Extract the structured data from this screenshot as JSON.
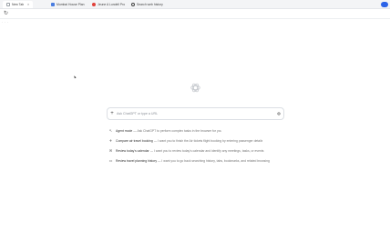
{
  "tabs": [
    {
      "label": "New Tab",
      "icon": "new-tab-icon",
      "color": "#9aa0a6",
      "active": true
    },
    {
      "label": "Mumbai House Plan",
      "icon": "doc-icon",
      "color": "#4a7de0",
      "active": false
    },
    {
      "label": "Jeune A Lundell Pro",
      "icon": "brand-icon",
      "color": "#e0403a",
      "active": false
    },
    {
      "label": "Search web history",
      "icon": "search-icon",
      "color": "#444444",
      "active": false
    }
  ],
  "toolbar": {
    "reload_icon": "reload-icon",
    "overflow_text": "· · ·"
  },
  "search": {
    "placeholder": "Ask ChatGPT or type a URL"
  },
  "suggestions": [
    {
      "icon": "agent-icon",
      "title": "Agent mode",
      "desc": "— Ask ChatGPT to perform complex tasks in the browser for you"
    },
    {
      "icon": "flight-icon",
      "title": "Compare air travel booking",
      "desc": "— I want you to finish the Air tickets flight booking by entering passenger details"
    },
    {
      "icon": "email-icon",
      "title": "Review today's calendar",
      "desc": "— I want you to review today's calendar and identify any meetings, tasks, or events"
    },
    {
      "icon": "history-icon",
      "title": "Review travel planning history",
      "desc": "— I want you to go back searching history, tabs, bookmarks, and related browsing"
    }
  ],
  "accent_color": "#2c63e8"
}
